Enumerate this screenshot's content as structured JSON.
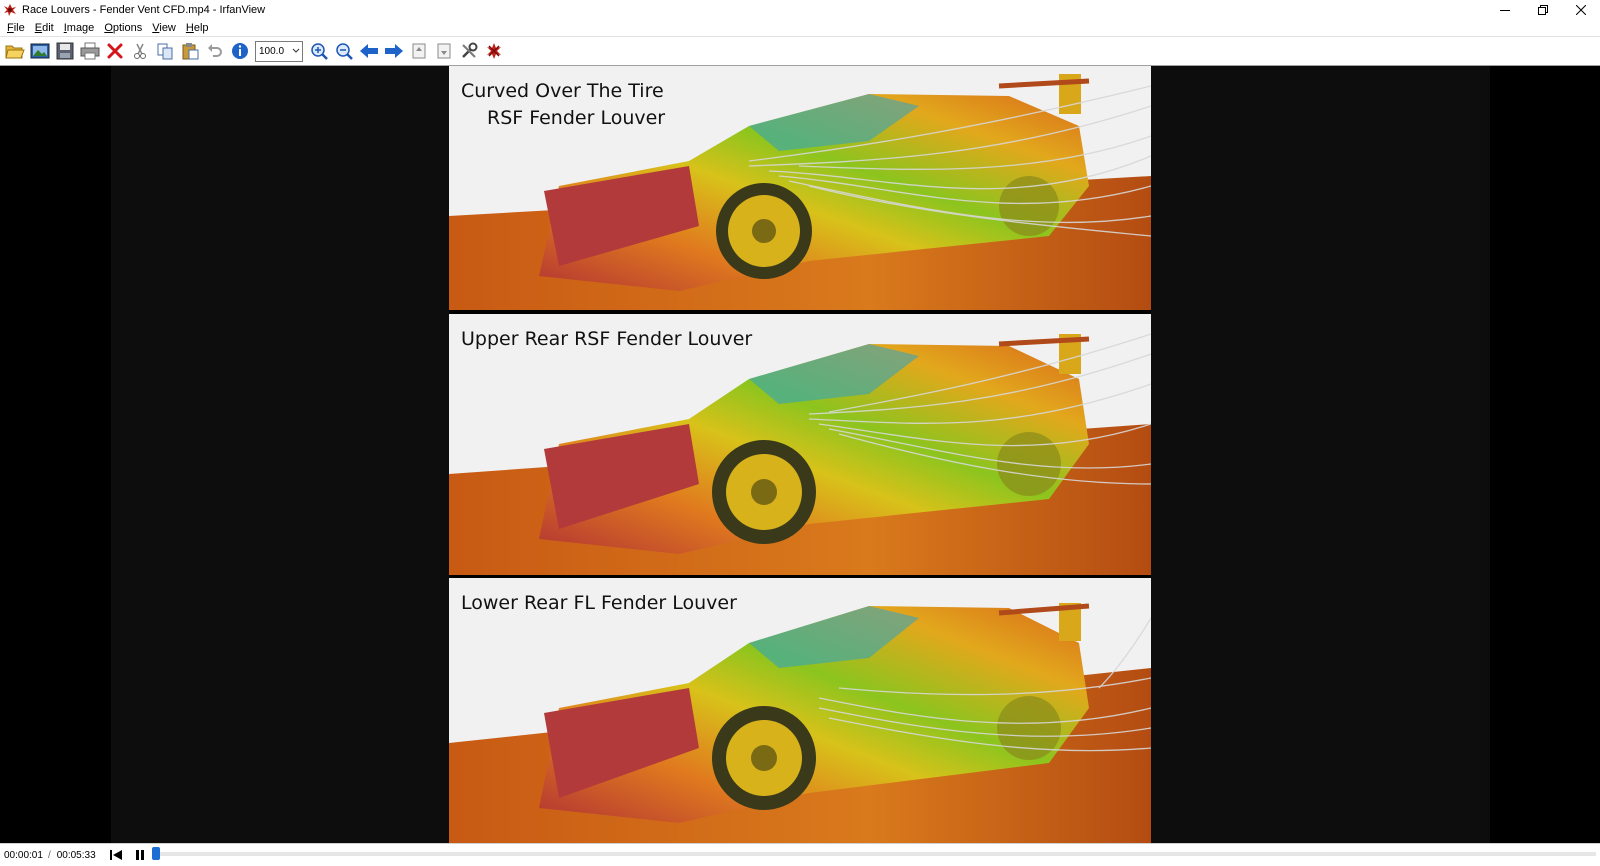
{
  "window": {
    "title": "Race Louvers - Fender Vent CFD.mp4 - IrfanView",
    "controls": [
      "minimize-icon",
      "restore-icon",
      "close-icon"
    ]
  },
  "menu": {
    "items": [
      {
        "label": "File"
      },
      {
        "label": "Edit"
      },
      {
        "label": "Image"
      },
      {
        "label": "Options"
      },
      {
        "label": "View"
      },
      {
        "label": "Help"
      }
    ]
  },
  "toolbar": {
    "icons": [
      "open-folder-icon",
      "thumbnails-icon",
      "save-icon",
      "print-icon",
      "delete-icon",
      "cut-icon",
      "copy-icon",
      "paste-icon",
      "undo-icon",
      "info-icon",
      "zoom-in-icon",
      "zoom-out-icon",
      "previous-icon",
      "next-icon",
      "first-page-icon",
      "last-page-icon",
      "settings-icon",
      "exit-icon"
    ],
    "zoom_value": "100.0"
  },
  "video": {
    "panels": [
      {
        "line1": "Curved Over The Tire",
        "line2": "RSF Fender Louver"
      },
      {
        "line1": "Upper Rear RSF Fender Louver",
        "line2": ""
      },
      {
        "line1": "Lower Rear FL Fender Louver",
        "line2": ""
      }
    ]
  },
  "player": {
    "current_time": "00:00:01",
    "separator": "/",
    "total_time": "00:05:33",
    "progress": 0.0
  },
  "colors": {
    "accent": "#1b6fd3",
    "viewer_bg": "#000000",
    "band_bg": "#0d0d0d"
  }
}
